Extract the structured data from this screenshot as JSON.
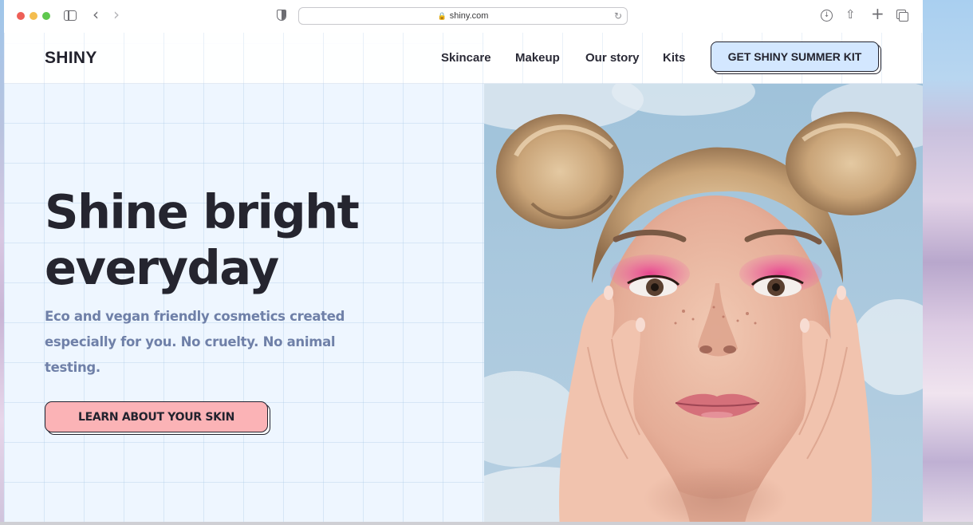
{
  "browser": {
    "url": "shiny.com"
  },
  "site": {
    "logo": "SHINY",
    "nav": [
      {
        "label": "Skincare"
      },
      {
        "label": "Makeup"
      },
      {
        "label": "Our story"
      },
      {
        "label": "Kits"
      }
    ],
    "cta_label": "GET SHINY SUMMER KIT"
  },
  "hero": {
    "title_line1": "Shine bright",
    "title_line2": "everyday",
    "subtitle": "Eco and vegan friendly cosmetics created especially for you.  No cruelty.  No animal testing.",
    "button_label": "LEARN ABOUT YOUR SKIN"
  },
  "colors": {
    "hero_bg": "#eef6ff",
    "cta_bg": "#d3e7ff",
    "button_bg": "#fbb3b6",
    "subtitle": "#6f80a8",
    "text_dark": "#25252f"
  }
}
